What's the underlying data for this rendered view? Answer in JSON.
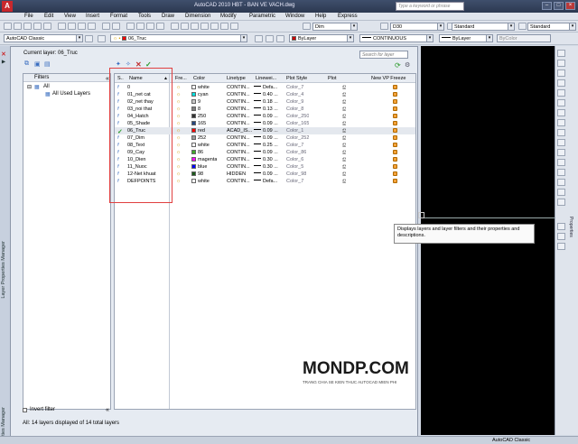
{
  "app": {
    "title": "AutoCAD 2010      HBT - BAN VE VACH.dwg",
    "search_placeholder": "Type a keyword or phrase",
    "logo": "A"
  },
  "menu": [
    "File",
    "Edit",
    "View",
    "Insert",
    "Format",
    "Tools",
    "Draw",
    "Dimension",
    "Modify",
    "Parametric",
    "Window",
    "Help",
    "Express"
  ],
  "toolbars": {
    "dim_style": "Dim",
    "d30": "D30",
    "text_style": "Standard",
    "table_style": "Standard",
    "workspace": "AutoCAD Classic",
    "layer": "06_Truc",
    "color": "ByLayer",
    "linetype": "CONTINUOUS",
    "lineweight": "ByLayer",
    "plotstyle": "ByColor"
  },
  "palette": {
    "vertical_title": "Layer Properties Manager",
    "vertical_title_2": "Layer Properties Manager",
    "current_layer": "Current layer: 06_Truc",
    "search_placeholder": "Search for layer",
    "filters_header": "Filters",
    "tree_all": "All",
    "tree_used": "All Used Layers",
    "invert_filter": "Invert filter",
    "status": "All: 14 layers displayed of 14 total layers",
    "columns": [
      "S..",
      "Name",
      "Fre...",
      "Color",
      "Linetype",
      "Linewei...",
      "Plot Style",
      "Plot",
      "New VP Freeze"
    ],
    "layers": [
      {
        "status": "",
        "name": "0",
        "color_name": "white",
        "color": "#ffffff",
        "linetype": "CONTIN...",
        "lineweight": "Defa...",
        "plot_style": "Color_7"
      },
      {
        "status": "",
        "name": "01_net cat",
        "color_name": "cyan",
        "color": "#00e0e0",
        "linetype": "CONTIN...",
        "lineweight": "0.40 ...",
        "plot_style": "Color_4"
      },
      {
        "status": "",
        "name": "02_net thay",
        "color_name": "9",
        "color": "#c8c8c8",
        "linetype": "CONTIN...",
        "lineweight": "0.18 ...",
        "plot_style": "Color_9"
      },
      {
        "status": "",
        "name": "03_noi that",
        "color_name": "8",
        "color": "#808080",
        "linetype": "CONTIN...",
        "lineweight": "0.13 ...",
        "plot_style": "Color_8"
      },
      {
        "status": "",
        "name": "04_Hatch",
        "color_name": "250",
        "color": "#333333",
        "linetype": "CONTIN...",
        "lineweight": "0.09 ...",
        "plot_style": "Color_250"
      },
      {
        "status": "",
        "name": "05_Shade",
        "color_name": "165",
        "color": "#26477f",
        "linetype": "CONTIN...",
        "lineweight": "0.09 ...",
        "plot_style": "Color_165"
      },
      {
        "status": "current",
        "name": "06_Truc",
        "color_name": "red",
        "color": "#ff0000",
        "linetype": "ACAD_IS...",
        "lineweight": "0.09 ...",
        "plot_style": "Color_1"
      },
      {
        "status": "",
        "name": "07_Dim",
        "color_name": "252",
        "color": "#9a9a9a",
        "linetype": "CONTIN...",
        "lineweight": "0.09 ...",
        "plot_style": "Color_252"
      },
      {
        "status": "",
        "name": "08_Text",
        "color_name": "white",
        "color": "#ffffff",
        "linetype": "CONTIN...",
        "lineweight": "0.25 ...",
        "plot_style": "Color_7"
      },
      {
        "status": "",
        "name": "09_Cay",
        "color_name": "86",
        "color": "#3faa2a",
        "linetype": "CONTIN...",
        "lineweight": "0.09 ...",
        "plot_style": "Color_86"
      },
      {
        "status": "",
        "name": "10_Dien",
        "color_name": "magenta",
        "color": "#ff00ff",
        "linetype": "CONTIN...",
        "lineweight": "0.30 ...",
        "plot_style": "Color_6"
      },
      {
        "status": "",
        "name": "11_Nuoc",
        "color_name": "blue",
        "color": "#0000ff",
        "linetype": "CONTIN...",
        "lineweight": "0.30 ...",
        "plot_style": "Color_5"
      },
      {
        "status": "",
        "name": "12-Net khuat",
        "color_name": "98",
        "color": "#1b5a1b",
        "linetype": "HIDDEN",
        "lineweight": "0.09 ...",
        "plot_style": "Color_98"
      },
      {
        "status": "",
        "name": "DEFPOINTS",
        "color_name": "white",
        "color": "#ffffff",
        "linetype": "CONTIN...",
        "lineweight": "Defa...",
        "plot_style": "Color_7"
      }
    ]
  },
  "tooltip": "Displays layers and layer filters and their properties and descriptions.",
  "watermark": {
    "big": "MONDP.COM",
    "small": "TRANG CHIA SE KIEN THUC AUTOCAD MIEN PHI"
  },
  "properties_label": "Properties",
  "statusbar": {
    "workspace": "AutoCAD Classic"
  }
}
